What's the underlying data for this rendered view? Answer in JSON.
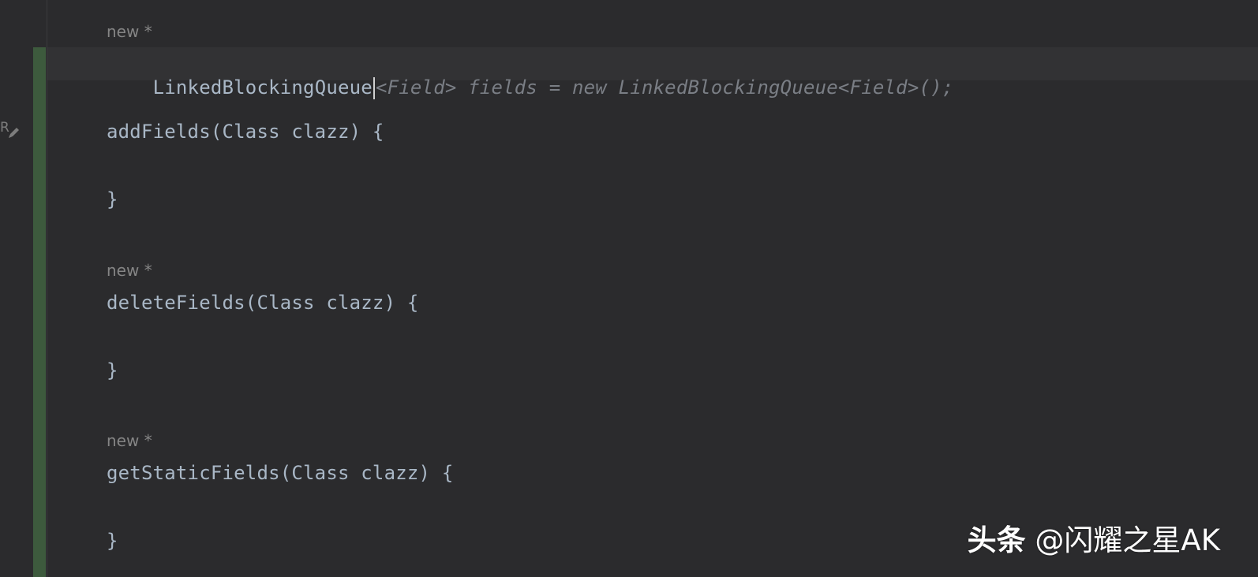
{
  "editor": {
    "lines": [
      {
        "kind": "hint",
        "text": "new *"
      },
      {
        "kind": "code",
        "typed": "LinkedBlockingQueue",
        "completion": "<Field> fields = new LinkedBlockingQueue<Field>();"
      },
      {
        "kind": "code",
        "text": "addFields(Class clazz) {"
      },
      {
        "kind": "code",
        "text": "}"
      },
      {
        "kind": "hint",
        "text": "new *"
      },
      {
        "kind": "code",
        "text": "deleteFields(Class clazz) {"
      },
      {
        "kind": "code",
        "text": "}"
      },
      {
        "kind": "hint",
        "text": "new *"
      },
      {
        "kind": "code",
        "text": "getStaticFields(Class clazz) {"
      },
      {
        "kind": "code",
        "text": "}"
      }
    ]
  },
  "gutter": {
    "icon": "reviewer-edit-icon",
    "icon_letter": "R"
  },
  "watermark": {
    "brand": "头条",
    "handle": "@闪耀之星AK"
  },
  "colors": {
    "background": "#2b2b2d",
    "current_line": "#323234",
    "code_text": "#a9b7c6",
    "ghost_text": "#7a7e85",
    "hint_text": "#858585",
    "change_marker": "#3d5a3d"
  }
}
